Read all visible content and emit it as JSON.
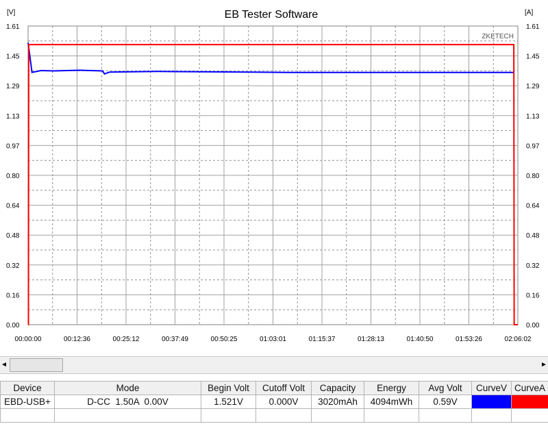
{
  "chart_data": {
    "type": "line",
    "title": "EB Tester Software",
    "watermark": "ZKETECH",
    "left_unit": "[V]",
    "right_unit": "[A]",
    "ylim": [
      0,
      1.61
    ],
    "y_ticks": [
      "1.61",
      "1.45",
      "1.29",
      "1.13",
      "0.97",
      "0.80",
      "0.64",
      "0.48",
      "0.32",
      "0.16",
      "0.00"
    ],
    "x_ticks": [
      "00:00:00",
      "00:12:36",
      "00:25:12",
      "00:37:49",
      "00:50:25",
      "01:03:01",
      "01:15:37",
      "01:28:13",
      "01:40:50",
      "01:53:26",
      "02:06:02"
    ],
    "xlim_seconds": [
      0,
      7562
    ],
    "grid": true,
    "series": [
      {
        "axis": "left",
        "color": "#0000ff",
        "points": [
          [
            0,
            1.52
          ],
          [
            60,
            1.36
          ],
          [
            200,
            1.37
          ],
          [
            400,
            1.368
          ],
          [
            800,
            1.372
          ],
          [
            1150,
            1.368
          ],
          [
            1180,
            1.352
          ],
          [
            1260,
            1.362
          ],
          [
            2000,
            1.365
          ],
          [
            4000,
            1.36
          ],
          [
            6000,
            1.36
          ],
          [
            7500,
            1.36
          ]
        ]
      },
      {
        "axis": "right",
        "color": "#ff0000",
        "points": [
          [
            0,
            0
          ],
          [
            5,
            0
          ],
          [
            10,
            1.51
          ],
          [
            7500,
            1.51
          ],
          [
            7505,
            0
          ],
          [
            7562,
            0
          ]
        ]
      }
    ]
  },
  "scrollbar": {
    "left_arrow": "◄",
    "right_arrow": "►"
  },
  "table": {
    "headers": [
      "Device",
      "Mode",
      "Begin Volt",
      "Cutoff Volt",
      "Capacity",
      "Energy",
      "Avg Volt",
      "CurveV",
      "CurveA"
    ],
    "row": [
      "EBD-USB+",
      "D-CC  1.50A  0.00V",
      "1.521V",
      "0.000V",
      "3020mAh",
      "4094mWh",
      "0.59V"
    ],
    "curve_v_color": "#0000ff",
    "curve_a_color": "#ff0000"
  }
}
